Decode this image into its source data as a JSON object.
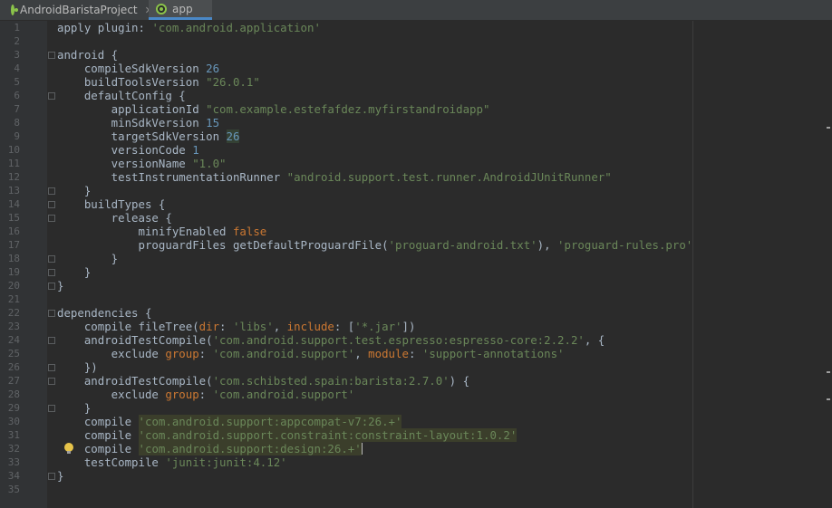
{
  "tabs": [
    {
      "label": "AndroidBaristaProject",
      "icon": "gradle-icon",
      "active": false
    },
    {
      "label": "app",
      "icon": "gradle-icon",
      "active": true
    }
  ],
  "editor": {
    "line_numbers": [
      "1",
      "2",
      "3",
      "4",
      "5",
      "6",
      "7",
      "8",
      "9",
      "10",
      "11",
      "12",
      "13",
      "14",
      "15",
      "16",
      "17",
      "18",
      "19",
      "20",
      "21",
      "22",
      "23",
      "24",
      "25",
      "26",
      "27",
      "28",
      "29",
      "30",
      "31",
      "32",
      "33",
      "34",
      "35"
    ],
    "lines": [
      [
        {
          "t": "apply plugin: "
        },
        {
          "t": "'com.android.application'",
          "c": "str"
        }
      ],
      [],
      [
        {
          "t": "android {"
        }
      ],
      [
        {
          "t": "    compileSdkVersion "
        },
        {
          "t": "26",
          "c": "num"
        }
      ],
      [
        {
          "t": "    buildToolsVersion "
        },
        {
          "t": "\"26.0.1\"",
          "c": "str"
        }
      ],
      [
        {
          "t": "    defaultConfig {"
        }
      ],
      [
        {
          "t": "        applicationId "
        },
        {
          "t": "\"com.example.estefafdez.myfirstandroidapp\"",
          "c": "str"
        }
      ],
      [
        {
          "t": "        minSdkVersion "
        },
        {
          "t": "15",
          "c": "num"
        }
      ],
      [
        {
          "t": "        targetSdkVersion "
        },
        {
          "t": "26",
          "c": "num hlnum"
        }
      ],
      [
        {
          "t": "        versionCode "
        },
        {
          "t": "1",
          "c": "num"
        }
      ],
      [
        {
          "t": "        versionName "
        },
        {
          "t": "\"1.0\"",
          "c": "str"
        }
      ],
      [
        {
          "t": "        testInstrumentationRunner "
        },
        {
          "t": "\"android.support.test.runner.AndroidJUnitRunner\"",
          "c": "str"
        }
      ],
      [
        {
          "t": "    }"
        }
      ],
      [
        {
          "t": "    buildTypes {"
        }
      ],
      [
        {
          "t": "        release {"
        }
      ],
      [
        {
          "t": "            minifyEnabled "
        },
        {
          "t": "false",
          "c": "kw"
        }
      ],
      [
        {
          "t": "            proguardFiles getDefaultProguardFile("
        },
        {
          "t": "'proguard-android.txt'",
          "c": "str"
        },
        {
          "t": "), "
        },
        {
          "t": "'proguard-rules.pro'",
          "c": "str"
        }
      ],
      [
        {
          "t": "        }"
        }
      ],
      [
        {
          "t": "    }"
        }
      ],
      [
        {
          "t": "}"
        }
      ],
      [],
      [
        {
          "t": "dependencies {"
        }
      ],
      [
        {
          "t": "    compile fileTree("
        },
        {
          "t": "dir",
          "c": "kw"
        },
        {
          "t": ": "
        },
        {
          "t": "'libs'",
          "c": "str"
        },
        {
          "t": ", "
        },
        {
          "t": "include",
          "c": "kw"
        },
        {
          "t": ": ["
        },
        {
          "t": "'*.jar'",
          "c": "str"
        },
        {
          "t": "])"
        }
      ],
      [
        {
          "t": "    androidTestCompile("
        },
        {
          "t": "'com.android.support.test.espresso:espresso-core:2.2.2'",
          "c": "str"
        },
        {
          "t": ", {"
        }
      ],
      [
        {
          "t": "        exclude "
        },
        {
          "t": "group",
          "c": "kw"
        },
        {
          "t": ": "
        },
        {
          "t": "'com.android.support'",
          "c": "str"
        },
        {
          "t": ", "
        },
        {
          "t": "module",
          "c": "kw"
        },
        {
          "t": ": "
        },
        {
          "t": "'support-annotations'",
          "c": "str"
        }
      ],
      [
        {
          "t": "    })"
        }
      ],
      [
        {
          "t": "    androidTestCompile("
        },
        {
          "t": "'com.schibsted.spain:barista:2.7.0'",
          "c": "str"
        },
        {
          "t": ") {"
        }
      ],
      [
        {
          "t": "        exclude "
        },
        {
          "t": "group",
          "c": "kw"
        },
        {
          "t": ": "
        },
        {
          "t": "'com.android.support'",
          "c": "str"
        }
      ],
      [
        {
          "t": "    }"
        }
      ],
      [
        {
          "t": "    compile "
        },
        {
          "t": "'com.android.support:appcompat-v7:26.+'",
          "c": "str hl"
        }
      ],
      [
        {
          "t": "    compile "
        },
        {
          "t": "'com.android.support.constraint:constraint-layout:1.0.2'",
          "c": "str hl"
        }
      ],
      [
        {
          "t": "    compile "
        },
        {
          "t": "'com.android.support:design:26.+'",
          "c": "str hl"
        },
        {
          "t": "",
          "c": "caret"
        }
      ],
      [
        {
          "t": "    testCompile "
        },
        {
          "t": "'junit:junit:4.12'",
          "c": "str"
        }
      ],
      [
        {
          "t": "}"
        }
      ],
      []
    ],
    "fold_markers": [
      3,
      6,
      13,
      14,
      15,
      18,
      19,
      20,
      22,
      24,
      26,
      27,
      29,
      34
    ],
    "intention_bulb_line": 32,
    "colors": {
      "string": "#6a8759",
      "number": "#6897bb",
      "keyword": "#cc7832",
      "text": "#a9b7c6",
      "background": "#2b2b2b"
    }
  }
}
